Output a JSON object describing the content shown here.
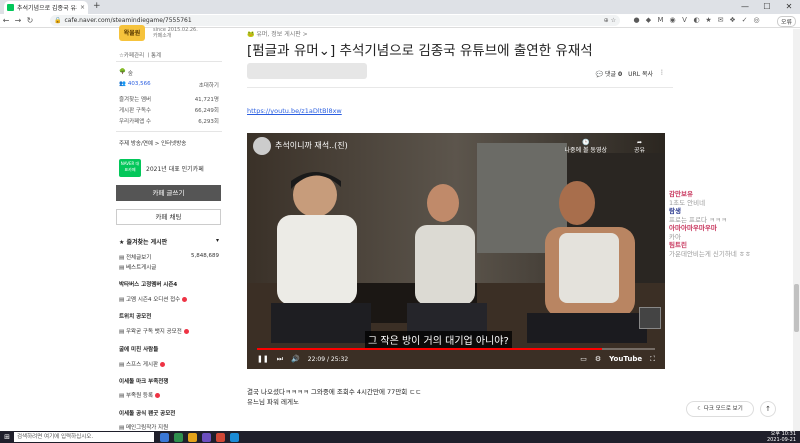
{
  "browser": {
    "tab_title": "추석기념으로 김종국 유튜...",
    "tab_close": "×",
    "new_tab": "+",
    "url": "cafe.naver.com/steamindiegame/7555761",
    "window_controls": [
      "—",
      "☐",
      "✕"
    ],
    "profile_label": "오류",
    "nav_back": "←",
    "nav_forward": "→",
    "nav_reload": "↻",
    "omni_icons": "⊕ ☆",
    "extensions": [
      "●",
      "◆",
      "M",
      "◉",
      "V",
      "◐",
      "★",
      "✉",
      "❖",
      "✓",
      "◎"
    ]
  },
  "sidebar": {
    "logo_text": "왁물원",
    "since": "since 2015.02.26.",
    "cafe_intro": "카페소개",
    "cafe_manage": "☆카페관리  ㅣ통계",
    "member_level": "숲",
    "members_count": "403,566",
    "invite": "초대하기",
    "stats": [
      {
        "label": "즐겨찾는 멤버",
        "value": "41,721명"
      },
      {
        "label": "게시판 구독수",
        "value": "66,249회"
      },
      {
        "label": "우리카페앱 수",
        "value": "6,293회"
      }
    ],
    "topic": "주제  방송/연예 > 인터넷방송",
    "badge_naver": "NAVER 대표카페",
    "badge_text": "2021년 대표 인기카페",
    "write_button": "카페 글쓰기",
    "chat_button": "카페 채팅",
    "fav_board_title": "★ 즐겨찾는 게시판",
    "fav_arrow": "▾",
    "menu": [
      {
        "label": "전체글보기",
        "count": "5,848,689"
      },
      {
        "label": "베스트게시글",
        "count": ""
      }
    ],
    "sections": [
      {
        "head": "박타버스 고정멤버 시즌4",
        "item": "고멤 시즌4 오디션 접수"
      },
      {
        "head": "트위치 공모전",
        "item": "우왁굳 구독 뱃지 공모전"
      },
      {
        "head": "굴에 미친 사람들",
        "item": "스프스 게시판"
      },
      {
        "head": "이세돌 마크 부족전쟁",
        "item": "부족원 등록"
      },
      {
        "head": "이세돌 공식 팬굿 공모전",
        "item": "메인그림작가 지원"
      }
    ]
  },
  "article": {
    "category": "유머, 정보 게시판 >",
    "title": "[펌글과 유머⌄] 추석기념으로 김종국 유튜브에 출연한 유재석",
    "comment_label": "댓글",
    "comment_count": "0",
    "url_copy": "URL 복사",
    "more": "⋮",
    "link": "https://youtu.be/z1aDltBl8xw",
    "video": {
      "title": "추석이니까 재석..(진)",
      "watch_later": "나중에 볼 동영상",
      "share": "공유",
      "subtitle": "그 작은 방이 거의 대기업 아니야?",
      "time": "22:09 / 25:32",
      "progress": 0.867,
      "logo": "YouTube",
      "play_icon": "❚❚",
      "next_icon": "⏭",
      "volume_icon": "🔊",
      "cc_icon": "▭",
      "settings_icon": "⚙",
      "fullscreen_icon": "⛶"
    },
    "body_lines": [
      "결국 나오셨다ㅋㅋㅋㅋ 그와중에 조회수 4시간만에 77만회 ㄷㄷ",
      "유느님 파워 레게노"
    ]
  },
  "chat": [
    {
      "name": "감만보유",
      "msg": "1초도 안비네",
      "color": "#c8375e"
    },
    {
      "name": "람생",
      "msg": "프로는 프로다 ㅋㅋㅋ",
      "color": "#2b3a8f"
    },
    {
      "name": "아마아마우마우마",
      "msg": "카아",
      "color": "#c8375e"
    },
    {
      "name": "팀트린",
      "msg": "가운데안비는게 신기하네 ㅎㅎ",
      "color": "#c8375e"
    }
  ],
  "buttons": {
    "dark_mode": "☾ 다크 모드로 보기",
    "to_top": "↑"
  },
  "taskbar": {
    "start": "⊞",
    "search": "검색하려면 여기에 입력하십시오.",
    "apps": [
      "#3a78d6",
      "#2f8f4e",
      "#e3a21a",
      "#6c4fbf",
      "#d14836",
      "#1b8bd6"
    ],
    "time": "오후 10:31",
    "date": "2021-09-21"
  }
}
